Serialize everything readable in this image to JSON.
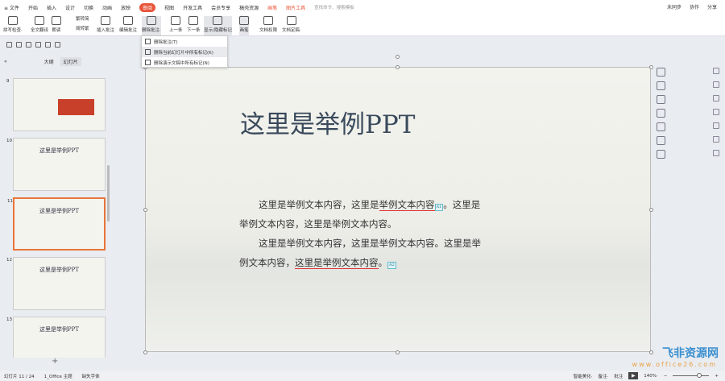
{
  "menu": {
    "items": [
      "≡ 文件",
      "开始",
      "插入",
      "设计",
      "切换",
      "动画",
      "放映",
      "审阅",
      "视图",
      "开发工具",
      "会员专享",
      "稿壳资源"
    ],
    "active_index": 7,
    "extra": [
      "画笔",
      "图片工具"
    ],
    "search": "查找命令、搜索模板",
    "right": [
      "未同步",
      "协作",
      "分享"
    ]
  },
  "ribbon": {
    "buttons": [
      "拼写检查·",
      "全文翻译",
      "朗读",
      "繁转简",
      "简转繁",
      "插入批注",
      "编辑批注",
      "删除批注·",
      "上一条",
      "下一条",
      "显示/隐藏标记",
      "画笔",
      "文档权限",
      "文档定稿·"
    ]
  },
  "dropdown": {
    "items": [
      "删除批注(T)",
      "删除当前幻灯片中所有标记(K)",
      "删除演示文稿中所有标记(N)"
    ]
  },
  "panel": {
    "tabs": [
      "大纲",
      "幻灯片"
    ],
    "collapse": "«",
    "add": "+"
  },
  "thumbs": [
    {
      "num": "9",
      "title": ""
    },
    {
      "num": "10",
      "title": "这里是举例PPT"
    },
    {
      "num": "11",
      "title": "这里是举例PPT"
    },
    {
      "num": "12",
      "title": "这里是举例PPT"
    },
    {
      "num": "13",
      "title": "这里是举例PPT"
    }
  ],
  "slide": {
    "title": "这里是举例PPT",
    "p1a": "这里是举例文本内容，这里是",
    "p1b": "举例文本内容",
    "p1c": "。这里是举例文本内容，这里是举例文本内容。",
    "tag1": "A1",
    "p2a": "这里是举例文本内容，这里是举例文本内容。这里是举例文本内容，",
    "p2b": "这里是举例文本内容",
    "p2c": "。",
    "tag2": "A2"
  },
  "status": {
    "slide": "幻灯片 11 / 24",
    "theme": "1_Office 主题",
    "font": "缺失字体",
    "beautify": "智能美化·",
    "notes": "备注·",
    "comments": "批注",
    "zoom": "140%·"
  },
  "watermark": {
    "brand": "飞非资源网",
    "url": "www.office26.com"
  }
}
